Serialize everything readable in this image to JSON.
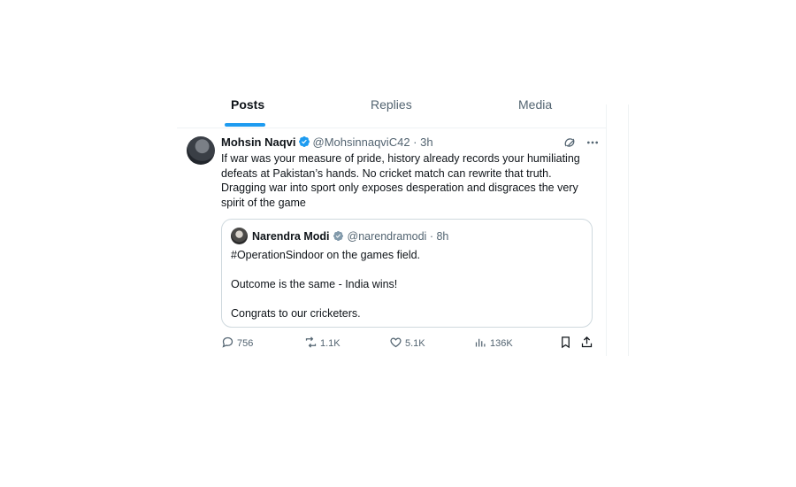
{
  "tabs": [
    {
      "label": "Posts",
      "active": true
    },
    {
      "label": "Replies",
      "active": false
    },
    {
      "label": "Media",
      "active": false
    }
  ],
  "tweet": {
    "author_name": "Mohsin Naqvi",
    "handle": "@MohsinnaqviC42",
    "separator": "·",
    "time": "3h",
    "text": "If war was your measure of pride, history already records your humiliating defeats at Pakistan’s hands. No cricket match can rewrite that truth. Dragging war into sport only exposes desperation and disgraces the very spirit of the game"
  },
  "quote": {
    "author_name": "Narendra Modi",
    "handle": "@narendramodi",
    "separator": "·",
    "time": "8h",
    "lines": [
      "#OperationSindoor on the games field.",
      "Outcome is the same - India wins!",
      "Congrats to our cricketers."
    ]
  },
  "actions": {
    "replies": "756",
    "reposts": "1.1K",
    "likes": "5.1K",
    "views": "136K"
  },
  "colors": {
    "accent": "#1d9bf0",
    "text": "#0f1419",
    "muted": "#536471",
    "border": "#cfd9de"
  },
  "icons": [
    "verified-badge-icon",
    "grok-icon",
    "more-icon",
    "reply-icon",
    "repost-icon",
    "like-icon",
    "views-icon",
    "bookmark-icon",
    "share-icon"
  ]
}
